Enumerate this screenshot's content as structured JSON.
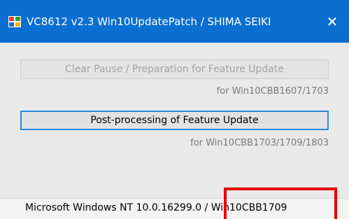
{
  "window": {
    "title": "VC8612 v2.3  Win10UpdatePatch / SHIMA SEIKI",
    "close_glyph": "✕",
    "icon": "app-icon"
  },
  "actions": [
    {
      "label": "Clear Pause / Preparation for Feature Update",
      "note": "for Win10CBB1607/1703",
      "enabled": false
    },
    {
      "label": "Post-processing of Feature Update",
      "note": "for Win10CBB1703/1709/1803",
      "enabled": true
    }
  ],
  "status": {
    "text": "Microsoft Windows NT 10.0.16299.0 / Win10CBB1709"
  },
  "colors": {
    "titlebar": "#0a6fd0",
    "client_bg": "#e9e9e9",
    "active_border": "#2b8ad8",
    "highlight": "#e60000"
  }
}
